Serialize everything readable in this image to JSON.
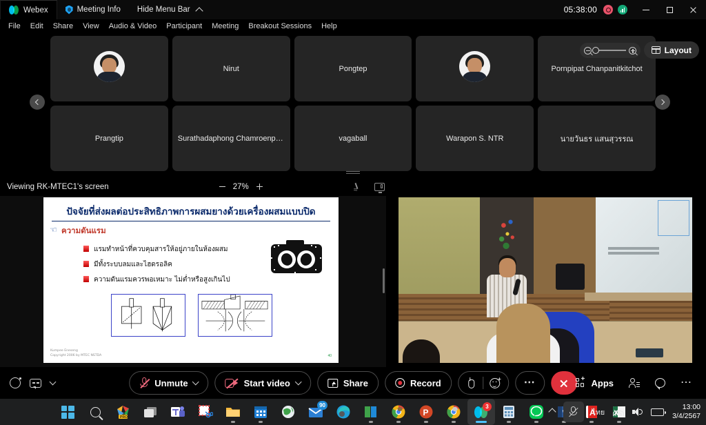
{
  "titlebar": {
    "app_name": "Webex",
    "meeting_info": "Meeting Info",
    "hide_menu_bar": "Hide Menu Bar",
    "timer": "05:38:00",
    "icons": {
      "webex_logo": "webex-logo",
      "meeting_info": "shield-icon",
      "collapse": "chevron-up-icon",
      "recording": "recording-indicator",
      "network": "network-quality-indicator",
      "minimize": "minimize-icon",
      "maximize": "maximize-icon",
      "close": "close-icon"
    }
  },
  "menubar": {
    "items": [
      {
        "label": "File"
      },
      {
        "label": "Edit"
      },
      {
        "label": "Share"
      },
      {
        "label": "View"
      },
      {
        "label": "Audio & Video"
      },
      {
        "label": "Participant"
      },
      {
        "label": "Meeting"
      },
      {
        "label": "Breakout Sessions"
      },
      {
        "label": "Help"
      }
    ]
  },
  "grid": {
    "tiles": [
      {
        "name": "",
        "avatar": true
      },
      {
        "name": "Nirut",
        "avatar": false
      },
      {
        "name": "Pongtep",
        "avatar": false
      },
      {
        "name": "",
        "avatar": true
      },
      {
        "name": "Pornpipat Chanpanitkitchot",
        "avatar": false
      },
      {
        "name": "Prangtip",
        "avatar": false
      },
      {
        "name": "Surathadaphong Chamroenpho...",
        "avatar": false
      },
      {
        "name": "vagaball",
        "avatar": false
      },
      {
        "name": "Warapon S. NTR",
        "avatar": false
      },
      {
        "name": "นายวันธร แสนสุวรรณ",
        "avatar": false
      }
    ],
    "prev_label": "Previous page",
    "next_label": "Next page",
    "layout_label": "Layout"
  },
  "sharebar": {
    "viewing_label": "Viewing RK-MTEC1's screen",
    "zoom_percent": "27%",
    "minus": "minus-icon",
    "plus": "plus-icon",
    "annotate": "annotate-icon",
    "display": "display-icon"
  },
  "slide": {
    "title": "ปัจจัยที่ส่งผลต่อประสิทธิภาพการผสมยางด้วยเครื่องผสมแบบปิด",
    "subtitle": "ความดันแรม",
    "bullets": [
      "แรมทำหน้าที่ควบคุมสารให้อยู่ภายในห้องผสม",
      "มีทั้งระบบลมและไฮดรอลิค",
      "ความดันแรมควรพอเหมาะ ไม่ต่ำหรือสูงเกินไป"
    ],
    "footer_line1": "Kumpee Eneseng",
    "footer_line2": "Copyright 2006 by MTEC NSTDA",
    "page_number": "40"
  },
  "controls": {
    "unmute": "Unmute",
    "start_video": "Start video",
    "share": "Share",
    "record": "Record",
    "apps": "Apps",
    "icons": {
      "record_dot": "record-circle-icon",
      "captions": "closed-captions-icon",
      "mic_off": "microphone-muted-icon",
      "camera_off": "camera-off-icon",
      "share_screen": "share-screen-icon",
      "reactions_hand": "raise-hand-icon",
      "reactions_emoji": "emoji-reaction-icon",
      "more": "more-options-icon",
      "leave": "leave-meeting-icon",
      "apps": "apps-grid-icon",
      "participants": "participants-icon",
      "chat": "chat-bubble-icon",
      "more_right": "more-options-icon"
    }
  },
  "taskbar": {
    "apps": [
      {
        "name": "start-button",
        "badge": "",
        "active": false,
        "running": false
      },
      {
        "name": "search-button",
        "badge": "",
        "active": false,
        "running": false
      },
      {
        "name": "office-icon",
        "badge": "",
        "active": false,
        "running": false
      },
      {
        "name": "task-view-icon",
        "badge": "",
        "active": false,
        "running": false
      },
      {
        "name": "microsoft-teams-icon",
        "badge": "",
        "active": false,
        "running": false
      },
      {
        "name": "snipping-tool-icon",
        "badge": "",
        "active": false,
        "running": false
      },
      {
        "name": "file-explorer-icon",
        "badge": "",
        "active": false,
        "running": true
      },
      {
        "name": "calendar-icon",
        "badge": "",
        "active": false,
        "running": true
      },
      {
        "name": "globe-icon",
        "badge": "",
        "active": false,
        "running": false
      },
      {
        "name": "mail-icon",
        "badge": "90",
        "active": false,
        "running": false
      },
      {
        "name": "edge-icon",
        "badge": "",
        "active": false,
        "running": false
      },
      {
        "name": "microsoft-store-icon",
        "badge": "",
        "active": false,
        "running": true
      },
      {
        "name": "chrome-icon",
        "badge": "",
        "active": false,
        "running": true
      },
      {
        "name": "powerpoint-icon",
        "badge": "",
        "active": false,
        "running": true
      },
      {
        "name": "chrome-icon-2",
        "badge": "",
        "active": false,
        "running": true
      },
      {
        "name": "webex-icon",
        "badge": "3",
        "active": true,
        "running": true
      },
      {
        "name": "calculator-icon",
        "badge": "",
        "active": false,
        "running": true
      },
      {
        "name": "line-icon",
        "badge": "",
        "active": false,
        "running": true
      },
      {
        "name": "word-icon",
        "badge": "",
        "active": false,
        "running": true
      },
      {
        "name": "acrobat-reader-icon",
        "badge": "",
        "active": false,
        "running": true
      },
      {
        "name": "excel-icon",
        "badge": "",
        "active": false,
        "running": true
      }
    ],
    "tray": {
      "overflow": "show-hidden-icons",
      "mic": "microphone-muted-icon",
      "language": "ไทย",
      "wifi": "wifi-icon",
      "volume": "volume-icon",
      "battery": "battery-icon",
      "time": "13:00",
      "date": "3/4/2567"
    }
  },
  "colors": {
    "accent_red": "#e0313c",
    "mute_red": "#f06a7e",
    "webex_blue": "#00bceb",
    "taskbar_bg": "#1e1f20",
    "tile_bg": "#252525"
  }
}
